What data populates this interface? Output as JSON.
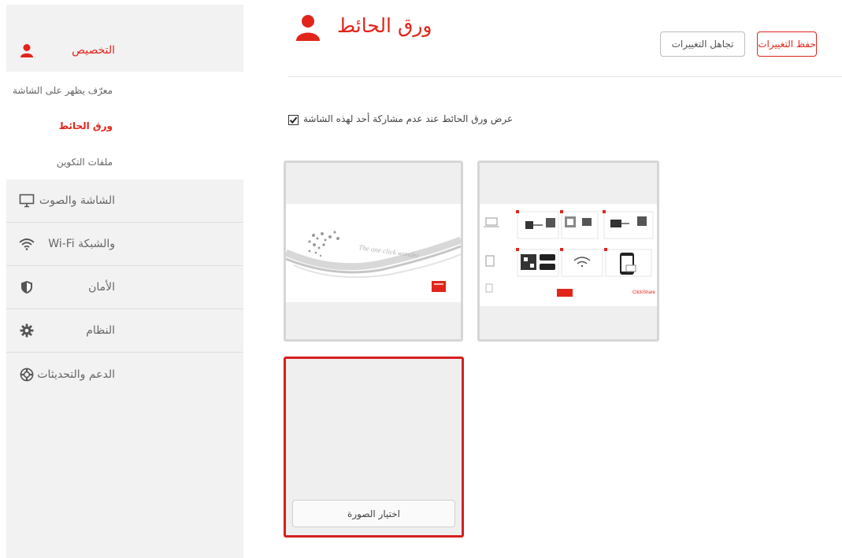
{
  "sidebar": {
    "items": [
      {
        "label": "التخصيص",
        "icon": "user-icon"
      },
      {
        "label": "الشاشة والصوت",
        "icon": "monitor-icon"
      },
      {
        "label": "والشبكة Wi-Fi",
        "icon": "wifi-icon"
      },
      {
        "label": "الأمان",
        "icon": "shield-icon"
      },
      {
        "label": "النظام",
        "icon": "gear-icon"
      },
      {
        "label": "الدعم والتحديثات",
        "icon": "lifebuoy-icon"
      }
    ],
    "subitems": [
      {
        "label": "معرّف يظهر على الشاشة"
      },
      {
        "label": "ورق الحائط",
        "active": true
      },
      {
        "label": "ملفات التكوين"
      }
    ]
  },
  "page": {
    "title": "ورق الحائط",
    "title_icon": "user-icon"
  },
  "toolbar": {
    "save_label": "حفظ التغييرات",
    "ignore_label": "تجاهل التغييرات"
  },
  "option": {
    "checkbox_label": "عرض ورق الحائط عند عدم مشاركة أحد لهذه الشاشة",
    "checked": true
  },
  "wallpapers": {
    "tile1_caption": "The one click wonder",
    "tile2_brand": "ClickShare",
    "choose_label": "اختيار الصورة"
  },
  "colors": {
    "accent": "#e1251b",
    "sidebar_bg": "#f2f2f2"
  }
}
